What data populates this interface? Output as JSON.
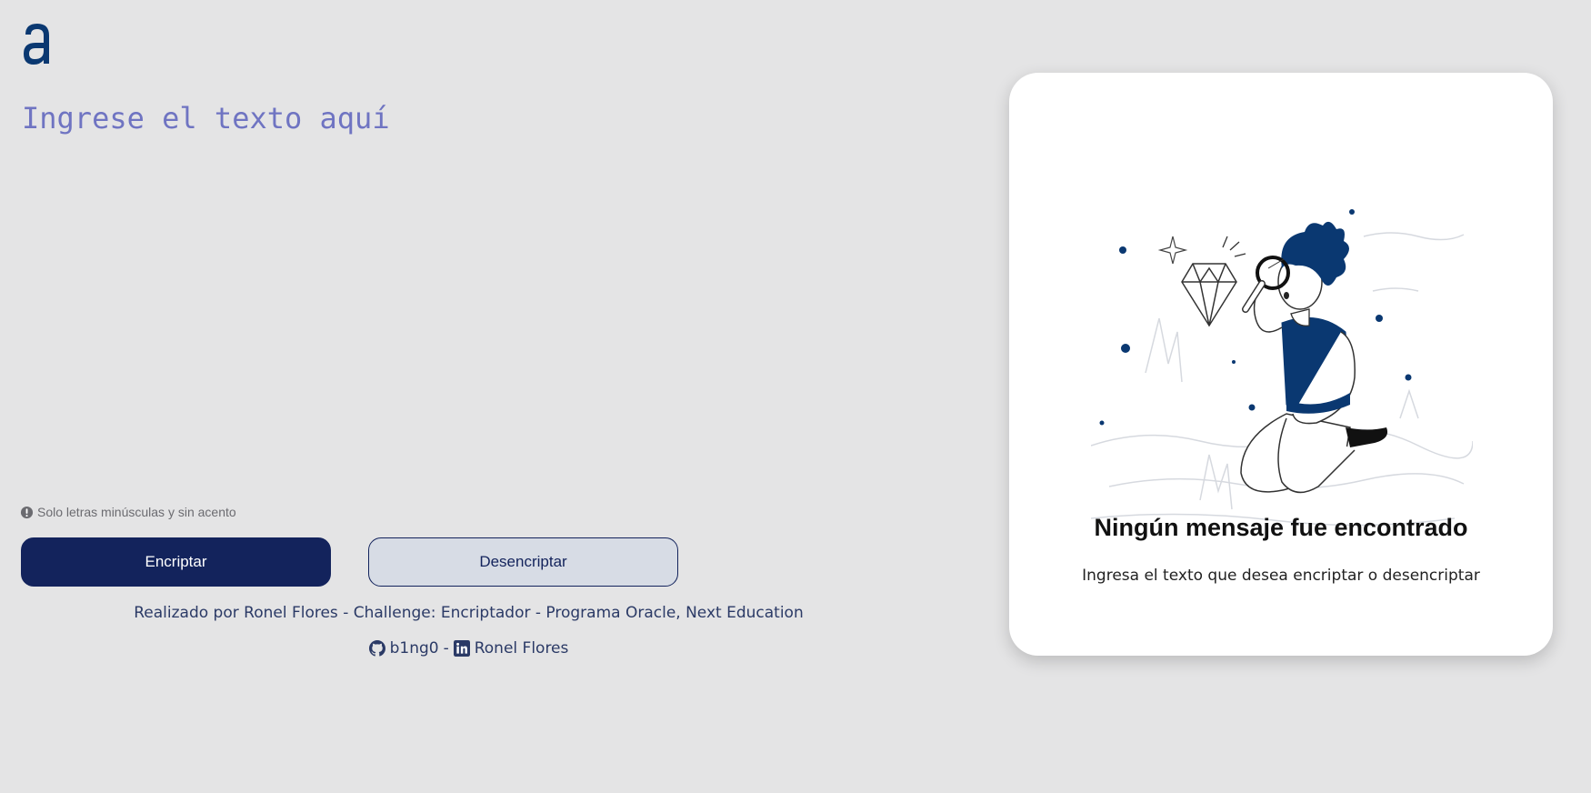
{
  "input": {
    "placeholder": "Ingrese el texto aquí"
  },
  "hint": {
    "text": "Solo letras minúsculas y sin acento"
  },
  "buttons": {
    "encrypt_label": "Encriptar",
    "decrypt_label": "Desencriptar"
  },
  "footer": {
    "credits": "Realizado por Ronel Flores - Challenge: Encriptador - Programa Oracle, Next Education",
    "github_label": "b1ng0",
    "separator": "-",
    "linkedin_label": "Ronel Flores"
  },
  "output": {
    "title": "Ningún mensaje fue encontrado",
    "subtitle": "Ingresa el texto que desea encriptar o desencriptar"
  },
  "colors": {
    "background": "#e4e4e5",
    "primary": "#13235c",
    "accent": "#0a3871",
    "placeholder": "#6f74c2",
    "card": "#ffffff"
  },
  "icons": {
    "logo": "alura-logo",
    "hint": "exclamation-circle-icon",
    "github": "github-icon",
    "linkedin": "linkedin-icon"
  }
}
